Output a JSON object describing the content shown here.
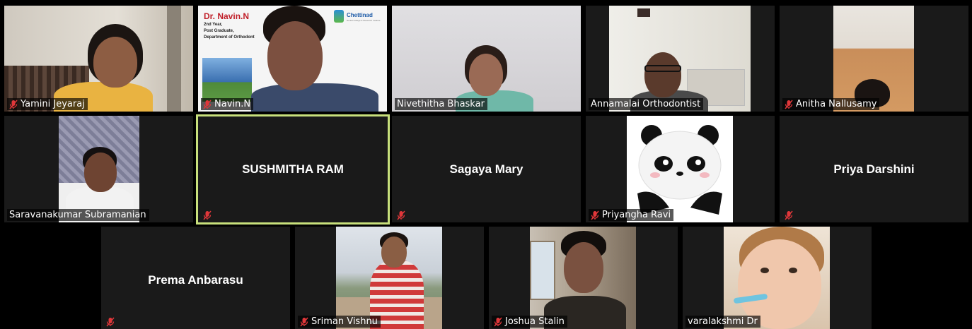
{
  "tiles": [
    {
      "name": "Yamini Jeyaraj",
      "muted": true
    },
    {
      "name": "Navin.N",
      "muted": true
    },
    {
      "name": "Nivethitha Bhaskar",
      "muted": false
    },
    {
      "name": "Annamalai Orthodontist",
      "muted": false
    },
    {
      "name": "Anitha Nallusamy",
      "muted": true
    },
    {
      "name": "Saravanakumar Subramanian",
      "muted": false
    },
    {
      "name": "SUSHMITHA RAM",
      "muted": true
    },
    {
      "name": "Sagaya Mary",
      "muted": true
    },
    {
      "name": "Priyangha Ravi",
      "muted": true
    },
    {
      "name": "Priya Darshini",
      "muted": true
    },
    {
      "name": "Prema Anbarasu",
      "muted": true
    },
    {
      "name": "Sriman Vishnu",
      "muted": true
    },
    {
      "name": "Joshua Stalin",
      "muted": true
    },
    {
      "name": "varalakshmi Dr",
      "muted": false
    }
  ],
  "slide": {
    "title": "Dr. Navin.N",
    "line1": "2nd Year,",
    "line2": "Post Graduate,",
    "line3": "Department of Orthodont",
    "logo_text": "Chettinad",
    "logo_sub": "Dental College & Research Institute"
  },
  "colors": {
    "active_border": "#c8e07c",
    "tile_bg": "#1a1a1a",
    "muted_icon": "#e0373a"
  }
}
